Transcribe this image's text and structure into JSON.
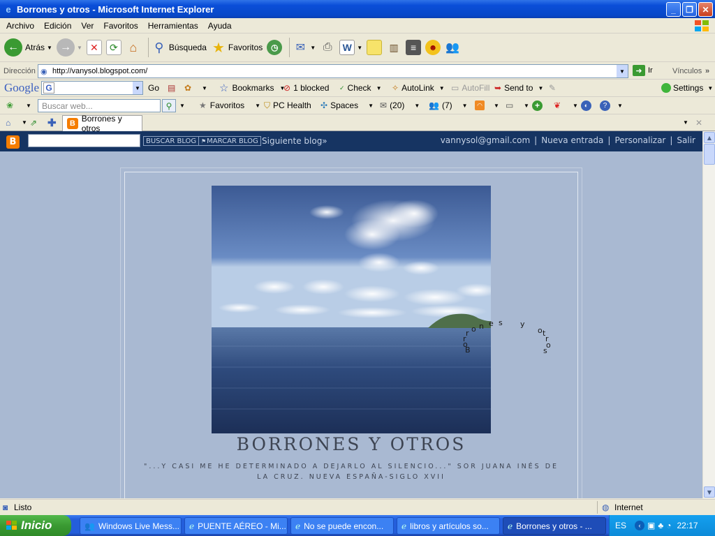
{
  "window": {
    "title": "Borrones y otros - Microsoft Internet Explorer"
  },
  "menu": [
    "Archivo",
    "Edición",
    "Ver",
    "Favoritos",
    "Herramientas",
    "Ayuda"
  ],
  "toolbar": {
    "back": "Atrás",
    "search": "Búsqueda",
    "favorites": "Favoritos"
  },
  "address": {
    "label": "Dirección",
    "url": "http://vanysol.blogspot.com/",
    "go": "Ir",
    "links": "Vínculos"
  },
  "google": {
    "logo": "Google",
    "go": "Go",
    "bookmarks": "Bookmarks",
    "blocked": "1 blocked",
    "check": "Check",
    "autolink": "AutoLink",
    "autofill": "AutoFill",
    "sendto": "Send to",
    "settings": "Settings"
  },
  "live": {
    "search_placeholder": "Buscar web...",
    "favoritos": "Favoritos",
    "pchealth": "PC Health",
    "spaces": "Spaces",
    "mail_count": "(20)",
    "contacts_count": "(7)"
  },
  "tab": {
    "label": "Borrones y otros"
  },
  "blogger": {
    "buscar": "BUSCAR BLOG",
    "marcar": "MARCAR BLOG",
    "siguiente": "Siguiente blog»",
    "email": "vannysol@gmail.com",
    "sep1": "|",
    "nueva": "Nueva entrada",
    "sep2": "|",
    "personalizar": "Personalizar",
    "sep3": "|",
    "salir": "Salir"
  },
  "blog": {
    "title": "BORRONES Y OTROS",
    "description": "\"...Y CASI ME HE DETERMINADO A DEJARLO AL SILENCIO...\" SOR JUANA INÉS DE LA CRUZ. NUEVA ESPAÑA-SIGLO XVII",
    "animated_letters": [
      "B",
      "o",
      "r",
      "r",
      "o",
      "n",
      "e",
      "s",
      "y",
      "o",
      "t",
      "r",
      "o",
      "s"
    ]
  },
  "status": {
    "text": "Listo",
    "zone": "Internet"
  },
  "taskbar": {
    "start": "Inicio",
    "tasks": [
      "Windows Live Mess...",
      "PUENTE AÉREO - Mi...",
      "No se puede encon...",
      "libros y artículos so...",
      "Borrones y otros - ..."
    ],
    "lang": "ES",
    "clock": "22:17"
  },
  "colors": {
    "page_bg": "#a9b9d2",
    "navbar": "#163462",
    "title_text": "#3d4452"
  }
}
